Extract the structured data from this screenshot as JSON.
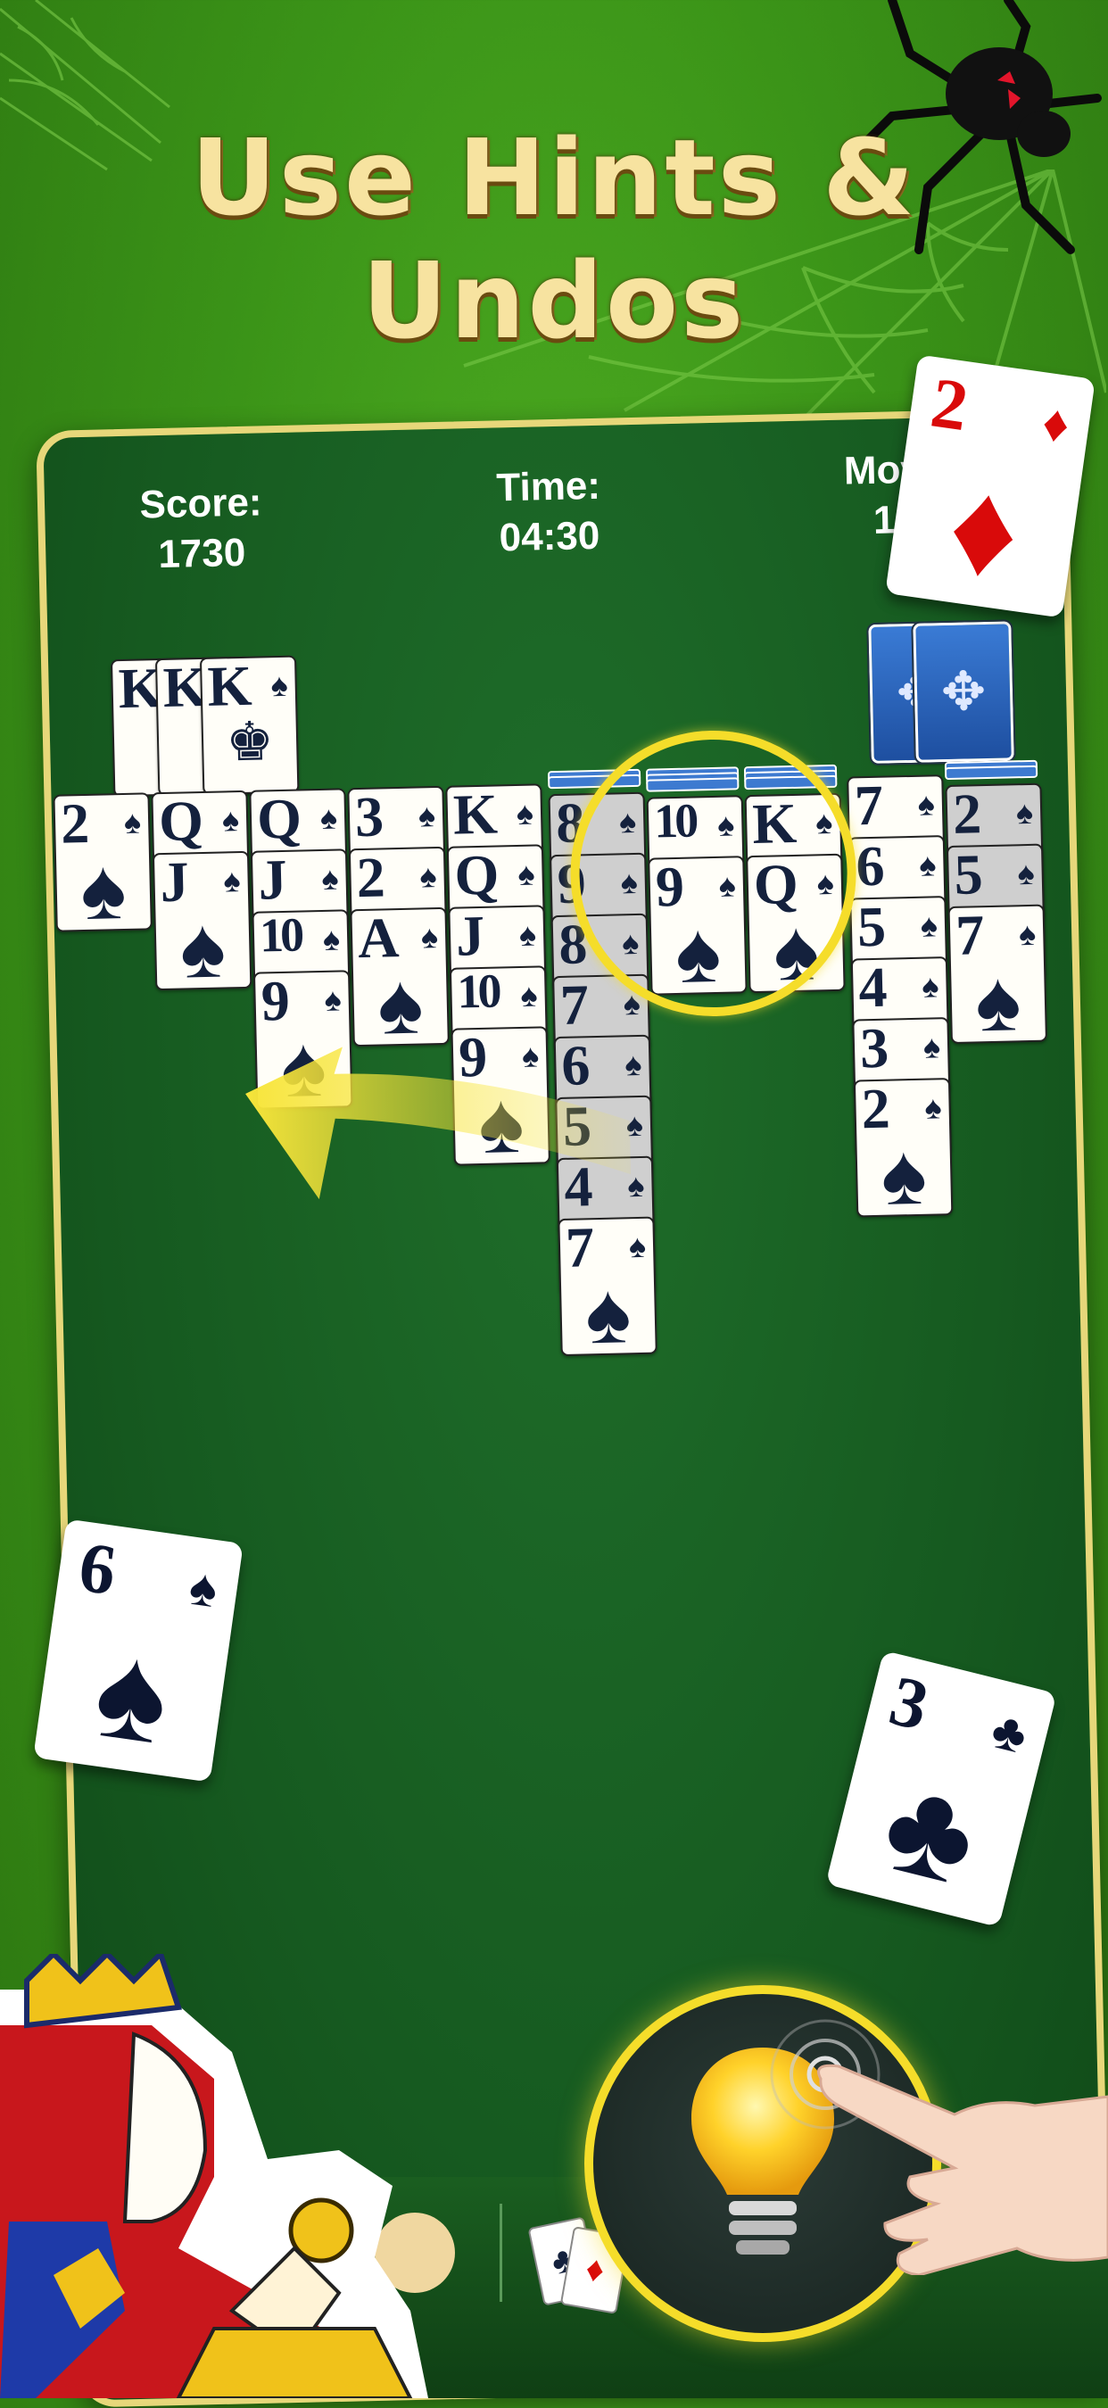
{
  "headline": "Use Hints & Undos",
  "stats": {
    "score_label": "Score:",
    "score_value": "1730",
    "time_label": "Time:",
    "time_value": "04:30",
    "moves_label": "Moves",
    "moves_value": "148"
  },
  "foundation": [
    {
      "rank": "K",
      "suit": "♠"
    },
    {
      "rank": "K",
      "suit": "♠"
    },
    {
      "rank": "K",
      "suit": "♠"
    }
  ],
  "tableau": [
    {
      "cards": [
        {
          "r": "2",
          "s": "♠"
        }
      ]
    },
    {
      "cards": [
        {
          "r": "Q",
          "s": "♠"
        },
        {
          "r": "J",
          "s": "♠"
        }
      ]
    },
    {
      "cards": [
        {
          "r": "Q",
          "s": "♠"
        },
        {
          "r": "J",
          "s": "♠"
        },
        {
          "r": "10",
          "s": "♠"
        },
        {
          "r": "9",
          "s": "♠"
        }
      ]
    },
    {
      "cards": [
        {
          "r": "3",
          "s": "♠"
        },
        {
          "r": "2",
          "s": "♠"
        },
        {
          "r": "A",
          "s": "♠"
        }
      ]
    },
    {
      "cards": [
        {
          "r": "K",
          "s": "♠"
        },
        {
          "r": "Q",
          "s": "♠"
        },
        {
          "r": "J",
          "s": "♠"
        },
        {
          "r": "10",
          "s": "♠"
        },
        {
          "r": "9",
          "s": "♠"
        }
      ]
    },
    {
      "cards": [
        {
          "r": "8",
          "s": "♠"
        },
        {
          "r": "9",
          "s": "♠"
        },
        {
          "r": "8",
          "s": "♠"
        },
        {
          "r": "7",
          "s": "♠"
        },
        {
          "r": "6",
          "s": "♠"
        },
        {
          "r": "5",
          "s": "♠"
        },
        {
          "r": "4",
          "s": "♠"
        },
        {
          "r": "7",
          "s": "♠"
        }
      ]
    },
    {
      "cards": [
        {
          "r": "10",
          "s": "♠"
        },
        {
          "r": "9",
          "s": "♠"
        }
      ]
    },
    {
      "cards": [
        {
          "r": "K",
          "s": "♠"
        },
        {
          "r": "Q",
          "s": "♠"
        }
      ]
    },
    {
      "cards": [
        {
          "r": "7",
          "s": "♠"
        },
        {
          "r": "6",
          "s": "♠"
        },
        {
          "r": "5",
          "s": "♠"
        },
        {
          "r": "4",
          "s": "♠"
        },
        {
          "r": "3",
          "s": "♠"
        },
        {
          "r": "2",
          "s": "♠"
        }
      ]
    },
    {
      "cards": [
        {
          "r": "2",
          "s": "♠"
        },
        {
          "r": "5",
          "s": "♠"
        },
        {
          "r": "7",
          "s": "♠"
        }
      ]
    }
  ],
  "floating_cards": [
    {
      "rank": "2",
      "suit": "♦",
      "color": "#d90a0a"
    },
    {
      "rank": "6",
      "suit": "♠",
      "color": "#0c1530"
    },
    {
      "rank": "3",
      "suit": "♣",
      "color": "#0c1530"
    }
  ],
  "colors": {
    "highlight": "#f5dd2a",
    "table_green": "#165a20",
    "border_gold": "#e7d77a"
  },
  "icons": {
    "hint": "lightbulb-icon",
    "stock": "card-back-icon",
    "spider": "spider-icon"
  }
}
